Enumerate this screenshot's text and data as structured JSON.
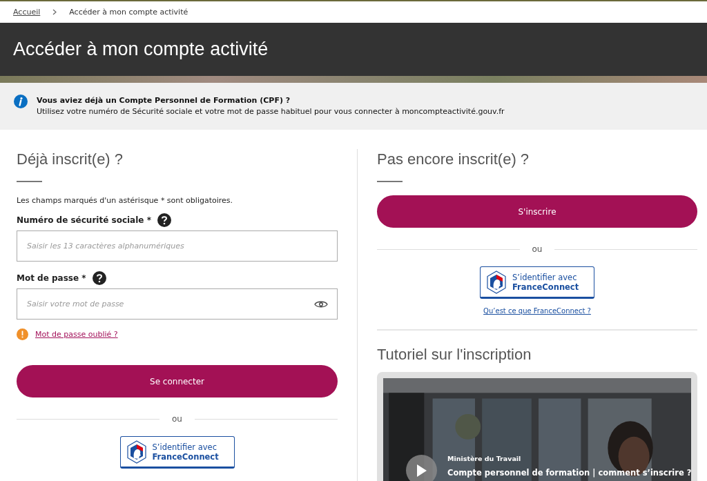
{
  "breadcrumb": [
    {
      "label": "Accueil",
      "kind": "link"
    },
    {
      "label": "Accéder à mon compte activité",
      "kind": "current"
    }
  ],
  "page_title": "Accéder à mon compte activité",
  "notice": {
    "title": "Vous aviez déjà un Compte Personnel de Formation (CPF) ?",
    "text": "Utilisez votre numéro de Sécurité sociale et votre mot de passe habituel pour vous connecter à moncompteactivité.gouv.fr"
  },
  "login": {
    "heading": "Déjà inscrit(e) ?",
    "required_note": "Les champs marqués d'un astérisque * sont obligatoires.",
    "fields": [
      {
        "label": "Numéro de sécurité sociale *",
        "placeholder": "Saisir les 13 caractères alphanumériques",
        "kind": "text"
      },
      {
        "label": "Mot de passe *",
        "placeholder": "Saisir votre mot de passe",
        "kind": "password"
      }
    ],
    "forgot_link": "Mot de passe oublié ?",
    "submit": "Se connecter",
    "separator": "ou",
    "franceconnect": {
      "line1": "S’identifier avec",
      "line2": "FranceConnect"
    }
  },
  "signup": {
    "heading": "Pas encore inscrit(e) ?",
    "button": "S'inscrire",
    "separator": "ou",
    "franceconnect": {
      "line1": "S’identifier avec",
      "line2": "FranceConnect"
    },
    "franceconnect_link": "Qu’est ce que FranceConnect ?",
    "tutorial": {
      "heading": "Tutoriel sur l'inscription",
      "video": {
        "kind": "picture",
        "channel": "Ministère du Travail",
        "title": "Compte personnel de formation | comment s’inscrire ?"
      }
    }
  }
}
